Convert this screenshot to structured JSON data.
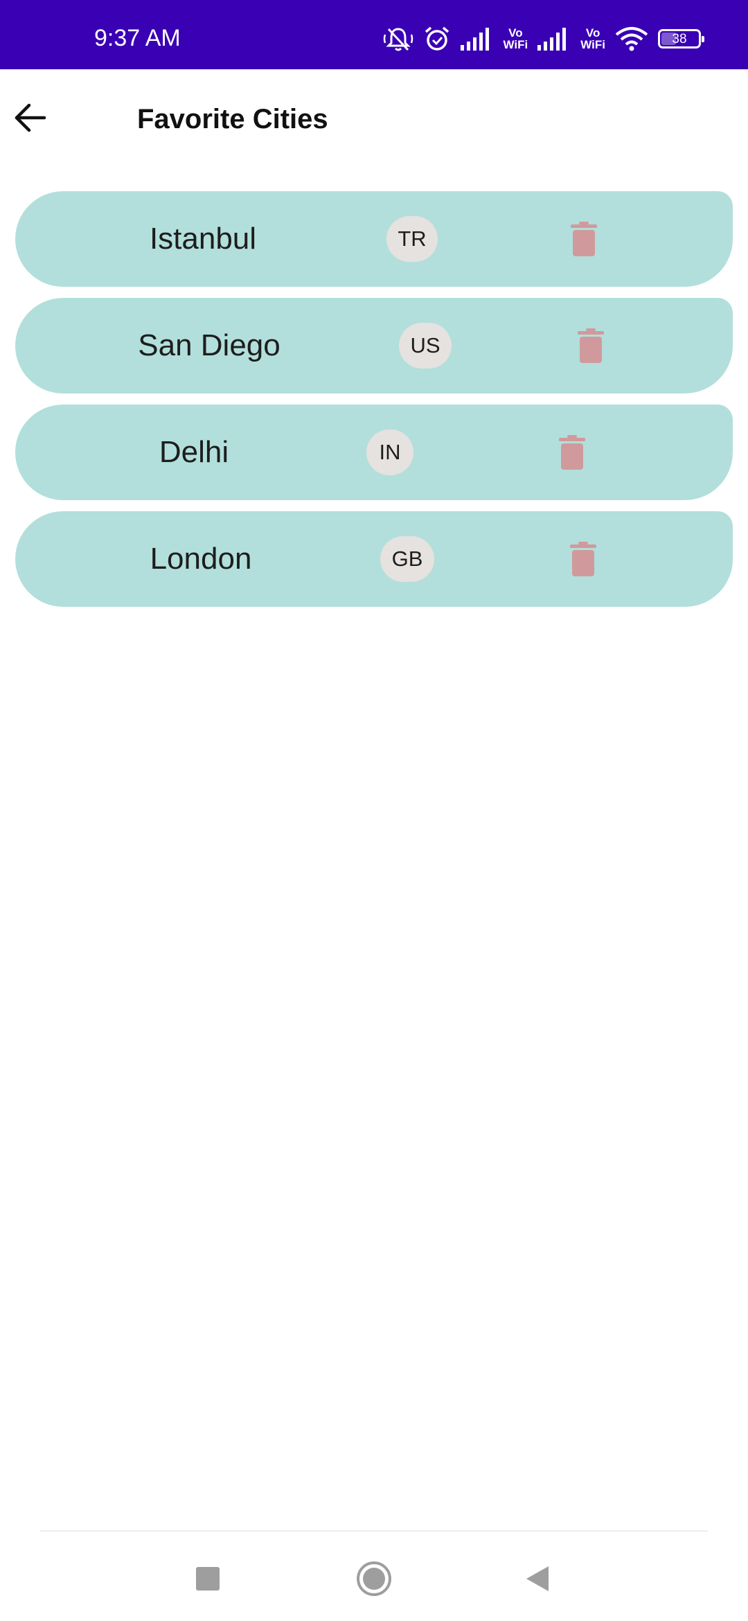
{
  "status_bar": {
    "time": "9:37 AM",
    "icons": [
      "mute-icon",
      "alarm-icon",
      "signal-icon",
      "vowifi-icon",
      "signal-icon",
      "vowifi-icon",
      "wifi-icon",
      "battery-icon"
    ],
    "vowifi_top": "Vo",
    "vowifi_bottom": "WiFi",
    "battery_level": "38",
    "background_color": "#3a00b4"
  },
  "app_bar": {
    "back_icon": "arrow-left-icon",
    "title": "Favorite Cities"
  },
  "cities": [
    {
      "name": "Istanbul",
      "country": "TR"
    },
    {
      "name": "San Diego",
      "country": "US"
    },
    {
      "name": "Delhi",
      "country": "IN"
    },
    {
      "name": "London",
      "country": "GB"
    }
  ],
  "colors": {
    "card_background": "#b2dfdb",
    "chip_background": "#e6e2df",
    "delete_icon": "#d09a9c"
  },
  "nav_bar": {
    "icons": [
      "recents-square-icon",
      "home-circle-icon",
      "back-triangle-icon"
    ]
  }
}
